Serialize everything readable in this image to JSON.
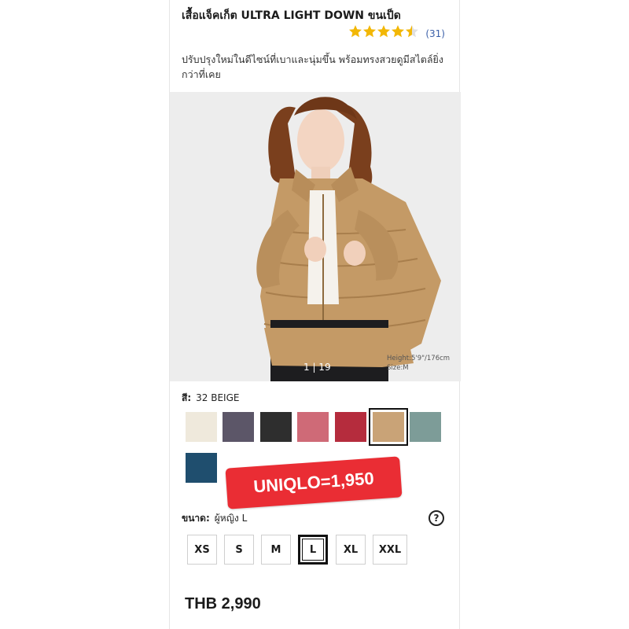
{
  "product": {
    "title": "เสื้อแจ็คเก็ต ULTRA LIGHT DOWN ขนเป็ด",
    "rating_stars": "★★★★★",
    "rating_value": 4.5,
    "rating_count": "(31)",
    "description": "ปรับปรุงใหม่ในดีไซน์ที่เบาและนุ่มขึ้น พร้อมทรงสวยดูมีสไตล์ยิ่งกว่าที่เคย"
  },
  "gallery": {
    "counter": "1 | 19",
    "model_height": "Height:5'9\"/176cm",
    "model_size": "Size:M"
  },
  "color": {
    "label": "สี:",
    "selected": "32 BEIGE",
    "swatches": [
      {
        "name": "off-white",
        "hex": "#efe9dc"
      },
      {
        "name": "purple-grey",
        "hex": "#5c5668"
      },
      {
        "name": "black",
        "hex": "#2e2e2e"
      },
      {
        "name": "pink",
        "hex": "#cf6a77"
      },
      {
        "name": "red",
        "hex": "#b52c3d"
      },
      {
        "name": "beige",
        "hex": "#c9a377",
        "selected": true
      },
      {
        "name": "grey-green",
        "hex": "#7d9c98"
      },
      {
        "name": "navy-teal",
        "hex": "#1f4e6e"
      }
    ]
  },
  "overlay": {
    "price_badge": "UNIQLO=1,950"
  },
  "size": {
    "label": "ขนาด:",
    "selected": "ผู้หญิง L",
    "options": [
      "XS",
      "S",
      "M",
      "L",
      "XL",
      "XXL"
    ],
    "selected_option": "L",
    "help_icon": "question-circle-icon"
  },
  "price": "THB 2,990"
}
